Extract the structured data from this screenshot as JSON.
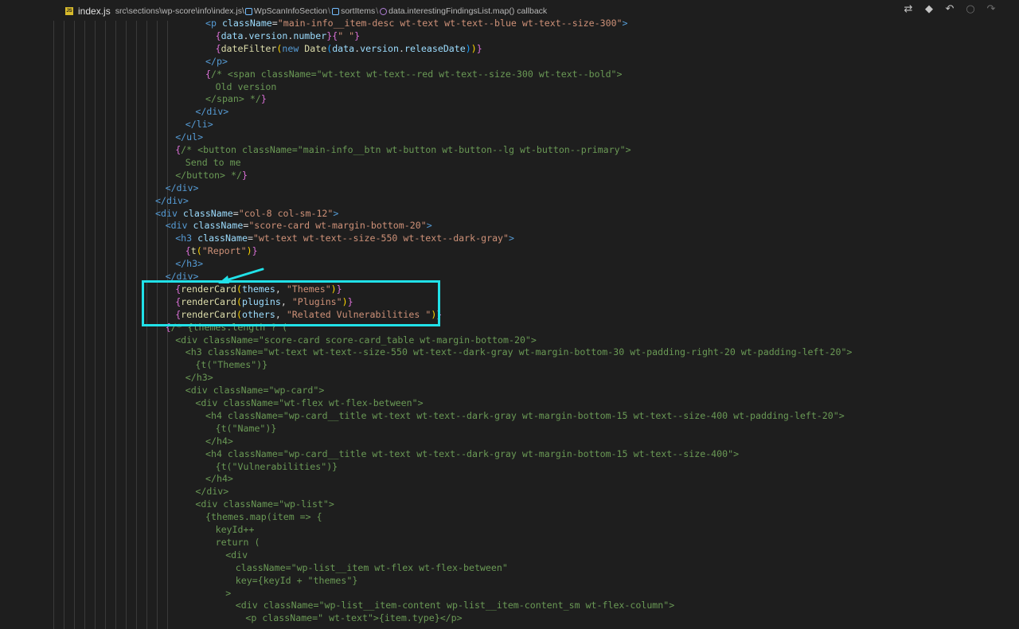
{
  "breadcrumb": {
    "file_name": "index.js",
    "path": "src\\sections\\wp-score\\info\\index.js\\",
    "component": "WpScanInfoSection",
    "method": "sortItems",
    "callback": "data.interestingFindingsList.map() callback"
  },
  "toolbar_icons": [
    "compare-changes-icon",
    "git-icon",
    "go-back-icon",
    "go-middle-icon",
    "go-forward-icon"
  ],
  "code_lines": [
    {
      "indent": 0,
      "segments": [
        [
          "tag",
          "<p "
        ],
        [
          "attr",
          "className"
        ],
        [
          "pl",
          "="
        ],
        [
          "str",
          "\"main-info__item-desc wt-text wt-text--blue wt-text--size-300\""
        ],
        [
          "tag",
          ">"
        ]
      ]
    },
    {
      "indent": 1,
      "segments": [
        [
          "br1",
          "{"
        ],
        [
          "attr",
          "data"
        ],
        [
          "pl",
          "."
        ],
        [
          "attr",
          "version"
        ],
        [
          "pl",
          "."
        ],
        [
          "attr",
          "number"
        ],
        [
          "br1",
          "}"
        ],
        [
          "br1",
          "{"
        ],
        [
          "str",
          "\" \""
        ],
        [
          "br1",
          "}"
        ]
      ]
    },
    {
      "indent": 1,
      "segments": [
        [
          "br1",
          "{"
        ],
        [
          "fnc",
          "dateFilter"
        ],
        [
          "br2",
          "("
        ],
        [
          "kw",
          "new "
        ],
        [
          "fnc",
          "Date"
        ],
        [
          "br3",
          "("
        ],
        [
          "attr",
          "data"
        ],
        [
          "pl",
          "."
        ],
        [
          "attr",
          "version"
        ],
        [
          "pl",
          "."
        ],
        [
          "attr",
          "releaseDate"
        ],
        [
          "br3",
          ")"
        ],
        [
          "br2",
          ")"
        ],
        [
          "br1",
          "}"
        ]
      ]
    },
    {
      "indent": 0,
      "segments": [
        [
          "tag",
          "</p>"
        ]
      ]
    },
    {
      "indent": 0,
      "segments": [
        [
          "br1",
          "{"
        ],
        [
          "cm",
          "/* <span className=\"wt-text wt-text--red wt-text--size-300 wt-text--bold\">"
        ]
      ]
    },
    {
      "indent": 1,
      "segments": [
        [
          "cm",
          "Old version"
        ]
      ]
    },
    {
      "indent": 0,
      "segments": [
        [
          "cm",
          "</span> */"
        ],
        [
          "br1",
          "}"
        ]
      ]
    },
    {
      "indent": -1,
      "segments": [
        [
          "tag",
          "</div>"
        ]
      ]
    },
    {
      "indent": -2,
      "segments": [
        [
          "tag",
          "</li>"
        ]
      ]
    },
    {
      "indent": -3,
      "segments": [
        [
          "tag",
          "</ul>"
        ]
      ]
    },
    {
      "indent": -3,
      "segments": [
        [
          "br1",
          "{"
        ],
        [
          "cm",
          "/* <button className=\"main-info__btn wt-button wt-button--lg wt-button--primary\">"
        ]
      ]
    },
    {
      "indent": -2,
      "segments": [
        [
          "cm",
          "Send to me"
        ]
      ]
    },
    {
      "indent": -3,
      "segments": [
        [
          "cm",
          "</button> */"
        ],
        [
          "br1",
          "}"
        ]
      ]
    },
    {
      "indent": -4,
      "segments": [
        [
          "tag",
          "</div>"
        ]
      ]
    },
    {
      "indent": -5,
      "segments": [
        [
          "tag",
          "</div>"
        ]
      ]
    },
    {
      "indent": -5,
      "segments": [
        [
          "tag",
          "<div "
        ],
        [
          "attr",
          "className"
        ],
        [
          "pl",
          "="
        ],
        [
          "str",
          "\"col-8 col-sm-12\""
        ],
        [
          "tag",
          ">"
        ]
      ]
    },
    {
      "indent": -4,
      "segments": [
        [
          "tag",
          "<div "
        ],
        [
          "attr",
          "className"
        ],
        [
          "pl",
          "="
        ],
        [
          "str",
          "\"score-card wt-margin-bottom-20\""
        ],
        [
          "tag",
          ">"
        ]
      ]
    },
    {
      "indent": -3,
      "segments": [
        [
          "tag",
          "<h3 "
        ],
        [
          "attr",
          "className"
        ],
        [
          "pl",
          "="
        ],
        [
          "str",
          "\"wt-text wt-text--size-550 wt-text--dark-gray\""
        ],
        [
          "tag",
          ">"
        ]
      ]
    },
    {
      "indent": -2,
      "segments": [
        [
          "br1",
          "{"
        ],
        [
          "fnc",
          "t"
        ],
        [
          "br2",
          "("
        ],
        [
          "str",
          "\"Report\""
        ],
        [
          "br2",
          ")"
        ],
        [
          "br1",
          "}"
        ]
      ]
    },
    {
      "indent": -3,
      "segments": [
        [
          "tag",
          "</h3>"
        ]
      ]
    },
    {
      "indent": -4,
      "segments": [
        [
          "tag",
          "</div>"
        ]
      ]
    },
    {
      "indent": -3,
      "segments": [
        [
          "br1",
          "{"
        ],
        [
          "fnc",
          "renderCard"
        ],
        [
          "br2",
          "("
        ],
        [
          "attr",
          "themes"
        ],
        [
          "pl",
          ", "
        ],
        [
          "str",
          "\"Themes\""
        ],
        [
          "br2",
          ")"
        ],
        [
          "br1",
          "}"
        ]
      ]
    },
    {
      "indent": -3,
      "segments": [
        [
          "br1",
          "{"
        ],
        [
          "fnc",
          "renderCard"
        ],
        [
          "br2",
          "("
        ],
        [
          "attr",
          "plugins"
        ],
        [
          "pl",
          ", "
        ],
        [
          "str",
          "\"Plugins\""
        ],
        [
          "br2",
          ")"
        ],
        [
          "br1",
          "}"
        ]
      ]
    },
    {
      "indent": -3,
      "segments": [
        [
          "br1",
          "{"
        ],
        [
          "fnc",
          "renderCard"
        ],
        [
          "br2",
          "("
        ],
        [
          "attr",
          "others"
        ],
        [
          "pl",
          ", "
        ],
        [
          "str",
          "\"Related Vulnerabilities \""
        ],
        [
          "br2",
          ")"
        ],
        [
          "br1",
          "}"
        ]
      ]
    },
    {
      "indent": -4,
      "segments": [
        [
          "br1",
          "{"
        ],
        [
          "cm",
          "/* {themes.length ? ("
        ]
      ]
    },
    {
      "indent": -3,
      "segments": [
        [
          "cm",
          "<div className=\"score-card score-card_table wt-margin-bottom-20\">"
        ]
      ]
    },
    {
      "indent": -2,
      "segments": [
        [
          "cm",
          "<h3 className=\"wt-text wt-text--size-550 wt-text--dark-gray wt-margin-bottom-30 wt-padding-right-20 wt-padding-left-20\">"
        ]
      ]
    },
    {
      "indent": -1,
      "segments": [
        [
          "cm",
          "{t(\"Themes\")}"
        ]
      ]
    },
    {
      "indent": -2,
      "segments": [
        [
          "cm",
          "</h3>"
        ]
      ]
    },
    {
      "indent": -2,
      "segments": [
        [
          "cm",
          "<div className=\"wp-card\">"
        ]
      ]
    },
    {
      "indent": -1,
      "segments": [
        [
          "cm",
          "<div className=\"wt-flex wt-flex-between\">"
        ]
      ]
    },
    {
      "indent": 0,
      "segments": [
        [
          "cm",
          "<h4 className=\"wp-card__title wt-text wt-text--dark-gray wt-margin-bottom-15 wt-text--size-400 wt-padding-left-20\">"
        ]
      ]
    },
    {
      "indent": 1,
      "segments": [
        [
          "cm",
          "{t(\"Name\")}"
        ]
      ]
    },
    {
      "indent": 0,
      "segments": [
        [
          "cm",
          "</h4>"
        ]
      ]
    },
    {
      "indent": 0,
      "segments": [
        [
          "cm",
          "<h4 className=\"wp-card__title wt-text wt-text--dark-gray wt-margin-bottom-15 wt-text--size-400\">"
        ]
      ]
    },
    {
      "indent": 1,
      "segments": [
        [
          "cm",
          "{t(\"Vulnerabilities\")}"
        ]
      ]
    },
    {
      "indent": 0,
      "segments": [
        [
          "cm",
          "</h4>"
        ]
      ]
    },
    {
      "indent": -1,
      "segments": [
        [
          "cm",
          "</div>"
        ]
      ]
    },
    {
      "indent": -1,
      "segments": [
        [
          "cm",
          "<div className=\"wp-list\">"
        ]
      ]
    },
    {
      "indent": 0,
      "segments": [
        [
          "cm",
          "{themes.map(item => {"
        ]
      ]
    },
    {
      "indent": 1,
      "segments": [
        [
          "cm",
          "keyId++"
        ]
      ]
    },
    {
      "indent": 1,
      "segments": [
        [
          "cm",
          "return ("
        ]
      ]
    },
    {
      "indent": 2,
      "segments": [
        [
          "cm",
          "<div"
        ]
      ]
    },
    {
      "indent": 3,
      "segments": [
        [
          "cm",
          "className=\"wp-list__item wt-flex wt-flex-between\""
        ]
      ]
    },
    {
      "indent": 3,
      "segments": [
        [
          "cm",
          "key={keyId + \"themes\"}"
        ]
      ]
    },
    {
      "indent": 2,
      "segments": [
        [
          "cm",
          ">"
        ]
      ]
    },
    {
      "indent": 3,
      "segments": [
        [
          "cm",
          "<div className=\"wp-list__item-content wp-list__item-content_sm wt-flex-column\">"
        ]
      ]
    },
    {
      "indent": 4,
      "segments": [
        [
          "cm",
          "<p className=\" wt-text\">{item.type}</p>"
        ]
      ]
    }
  ]
}
